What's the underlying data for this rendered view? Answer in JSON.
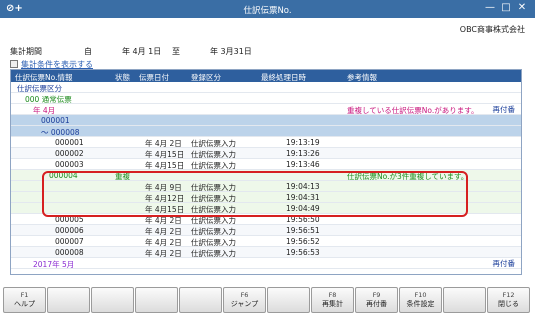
{
  "window": {
    "title": "仕訳伝票No.",
    "app_icon": "⊘+",
    "minimize": "—",
    "maximize": "□",
    "close": "✕"
  },
  "company": "OBC商事株式会社",
  "period": {
    "label": "集計期間",
    "from_label": "自",
    "from_date": "年 4月 1日",
    "to_label": "至",
    "to_date": "年 3月31日"
  },
  "filter_link": "集計条件を表示する",
  "table": {
    "columns": [
      "仕訳伝票No.情報",
      "状態",
      "伝票日付",
      "登録区分",
      "最終処理日時",
      "参考情報"
    ],
    "rows": [
      {
        "c1": "仕訳伝票区分",
        "c2": "",
        "c3": "",
        "c4": "",
        "c5": "",
        "c6": "",
        "style": "blue-text",
        "bg": ""
      },
      {
        "c1": "000 通常伝票",
        "c2": "",
        "c3": "",
        "c4": "",
        "c5": "",
        "c6": "",
        "style": "green-text",
        "bg": ""
      },
      {
        "c1": "年 4月",
        "c2": "",
        "c3": "",
        "c4": "",
        "c5": "",
        "c6": "重複している仕訳伝票No.があります。",
        "style": "magenta",
        "bg": "",
        "attach": "再付番"
      },
      {
        "c1": "000001",
        "c2": "",
        "c3": "",
        "c4": "",
        "c5": "",
        "c6": "",
        "style": "blue-text",
        "bg": "blue"
      },
      {
        "c1": "～ 000008",
        "c2": "",
        "c3": "",
        "c4": "",
        "c5": "",
        "c6": "",
        "style": "blue-text",
        "bg": "blue"
      },
      {
        "c1": "000001",
        "c2": "",
        "c3": "年 4月 2日",
        "c4": "仕訳伝票入力",
        "c5": "19:13:19",
        "c6": "",
        "style": "",
        "bg": ""
      },
      {
        "c1": "000002",
        "c2": "",
        "c3": "年 4月15日",
        "c4": "仕訳伝票入力",
        "c5": "19:13:26",
        "c6": "",
        "style": "",
        "bg": "alt"
      },
      {
        "c1": "000003",
        "c2": "",
        "c3": "年 4月15日",
        "c4": "仕訳伝票入力",
        "c5": "19:13:46",
        "c6": "",
        "style": "",
        "bg": ""
      },
      {
        "c1": "000004",
        "c2": "重複",
        "c3": "",
        "c4": "",
        "c5": "",
        "c6": "仕訳伝票No.が3件重複しています。",
        "style": "green-text",
        "bg": "green"
      },
      {
        "c1": "",
        "c2": "",
        "c3": "年 4月 9日",
        "c4": "仕訳伝票入力",
        "c5": "19:04:13",
        "c6": "",
        "style": "",
        "bg": "green"
      },
      {
        "c1": "",
        "c2": "",
        "c3": "年 4月12日",
        "c4": "仕訳伝票入力",
        "c5": "19:04:31",
        "c6": "",
        "style": "",
        "bg": "green"
      },
      {
        "c1": "",
        "c2": "",
        "c3": "年 4月15日",
        "c4": "仕訳伝票入力",
        "c5": "19:04:49",
        "c6": "",
        "style": "",
        "bg": "green"
      },
      {
        "c1": "000005",
        "c2": "",
        "c3": "年 4月 2日",
        "c4": "仕訳伝票入力",
        "c5": "19:56:50",
        "c6": "",
        "style": "",
        "bg": ""
      },
      {
        "c1": "000006",
        "c2": "",
        "c3": "年 4月 2日",
        "c4": "仕訳伝票入力",
        "c5": "19:56:51",
        "c6": "",
        "style": "",
        "bg": "alt"
      },
      {
        "c1": "000007",
        "c2": "",
        "c3": "年 4月 2日",
        "c4": "仕訳伝票入力",
        "c5": "19:56:52",
        "c6": "",
        "style": "",
        "bg": ""
      },
      {
        "c1": "000008",
        "c2": "",
        "c3": "年 4月 2日",
        "c4": "仕訳伝票入力",
        "c5": "19:56:53",
        "c6": "",
        "style": "",
        "bg": "alt"
      },
      {
        "c1": "2017年 5月",
        "c2": "",
        "c3": "",
        "c4": "",
        "c5": "",
        "c6": "",
        "style": "violet",
        "bg": "",
        "attach": "再付番"
      }
    ]
  },
  "fkeys": [
    {
      "key": "F1",
      "label": "ヘルプ"
    },
    {
      "key": "",
      "label": ""
    },
    {
      "key": "",
      "label": ""
    },
    {
      "key": "",
      "label": ""
    },
    {
      "key": "",
      "label": ""
    },
    {
      "key": "F6",
      "label": "ジャンプ"
    },
    {
      "key": "",
      "label": ""
    },
    {
      "key": "F8",
      "label": "再集計"
    },
    {
      "key": "F9",
      "label": "再付番"
    },
    {
      "key": "F10",
      "label": "条件設定"
    },
    {
      "key": "",
      "label": ""
    },
    {
      "key": "F12",
      "label": "閉じる"
    }
  ]
}
